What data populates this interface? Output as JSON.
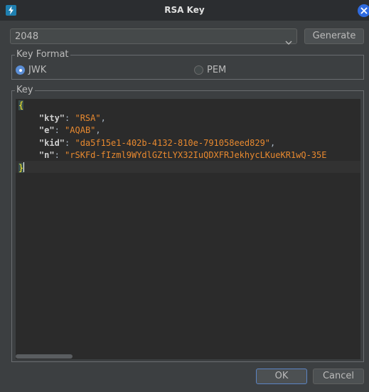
{
  "window": {
    "title": "RSA Key"
  },
  "key_size": {
    "selected": "2048"
  },
  "buttons": {
    "generate": "Generate",
    "ok": "OK",
    "cancel": "Cancel"
  },
  "key_format": {
    "title": "Key Format",
    "options": [
      {
        "label": "JWK",
        "selected": true
      },
      {
        "label": "PEM",
        "selected": false
      }
    ]
  },
  "key": {
    "title": "Key",
    "json": {
      "open": "{",
      "close": "}",
      "fields": [
        {
          "key": "\"kty\"",
          "value": "\"RSA\"",
          "trail": ","
        },
        {
          "key": "\"e\"",
          "value": "\"AQAB\"",
          "trail": ","
        },
        {
          "key": "\"kid\"",
          "value": "\"da5f15e1-402b-4132-810e-791058eed829\"",
          "trail": ","
        },
        {
          "key": "\"n\"",
          "value": "\"rSKFd-fIzml9WYdlGZtLYX32IuQDXFRJekhycLKueKR1wQ-35E",
          "trail": ""
        }
      ]
    }
  },
  "colors": {
    "background": "#3c3f41",
    "editor_bg": "#2b2b2b",
    "string": "#e8892f",
    "accent": "#5b8ed6",
    "close_button": "#2f6be0"
  },
  "icons": {
    "app": "lightning-icon",
    "close": "close-icon",
    "dropdown": "chevron-down-icon"
  }
}
